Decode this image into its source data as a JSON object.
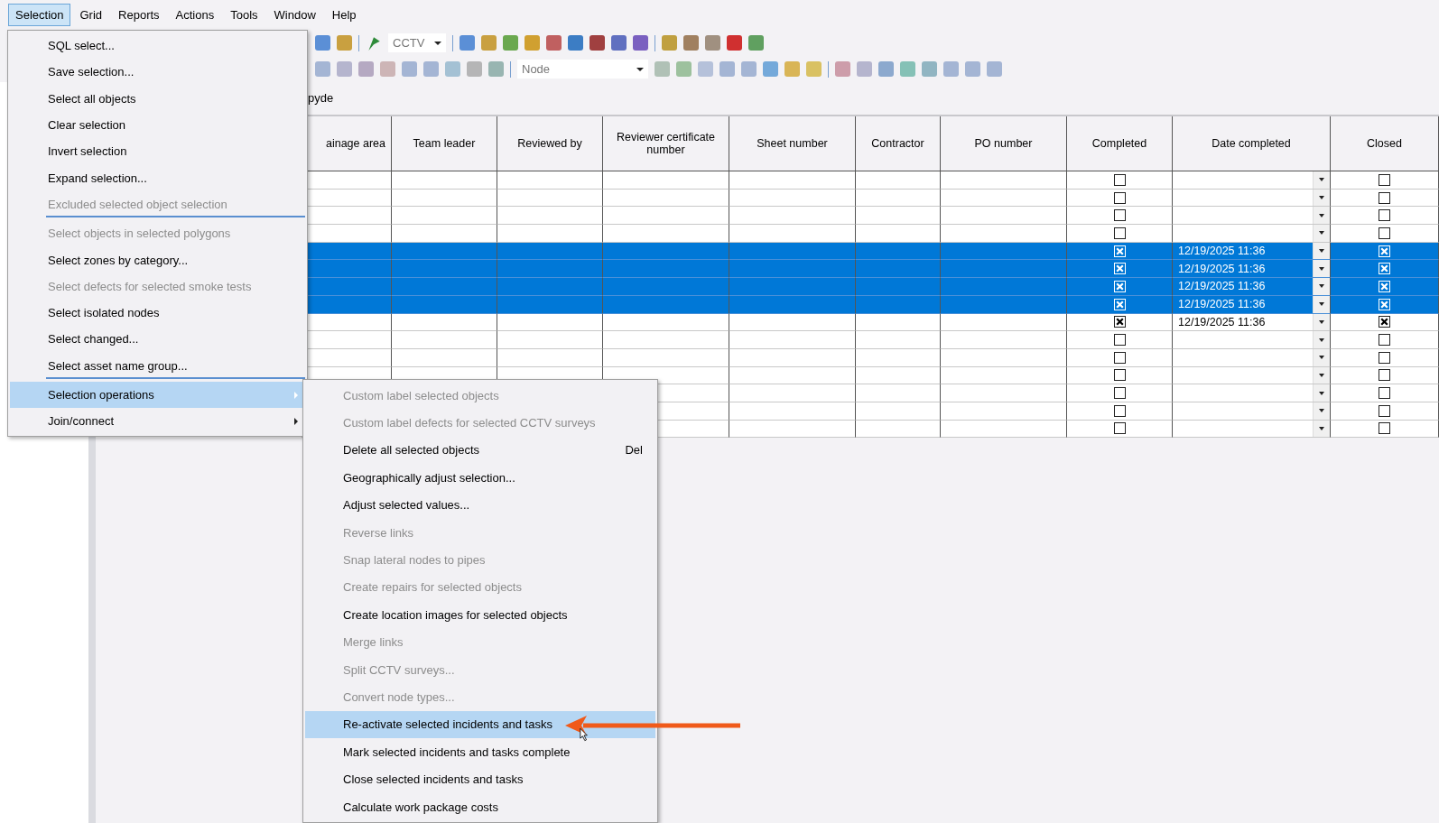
{
  "menubar": [
    {
      "label": "Selection",
      "selected": true
    },
    {
      "label": "Grid",
      "selected": false
    },
    {
      "label": "Reports",
      "selected": false
    },
    {
      "label": "Actions",
      "selected": false
    },
    {
      "label": "Tools",
      "selected": false
    },
    {
      "label": "Window",
      "selected": false
    },
    {
      "label": "Help",
      "selected": false
    }
  ],
  "toolbar": {
    "layer_combo": "CCTV",
    "object_combo": "Node"
  },
  "filter_field": {
    "value": "pyde"
  },
  "grid": {
    "columns": [
      "ainage area",
      "Team leader",
      "Reviewed by",
      "Reviewer certificate number",
      "Sheet number",
      "Contractor",
      "PO number",
      "Completed",
      "Date completed",
      "Closed"
    ],
    "rows": [
      {
        "selected": false,
        "completed": false,
        "date_completed": "",
        "closed": false
      },
      {
        "selected": false,
        "completed": false,
        "date_completed": "",
        "closed": false
      },
      {
        "selected": false,
        "completed": false,
        "date_completed": "",
        "closed": false
      },
      {
        "selected": false,
        "completed": false,
        "date_completed": "",
        "closed": false
      },
      {
        "selected": true,
        "completed": true,
        "date_completed": "12/19/2025 11:36",
        "closed": true
      },
      {
        "selected": true,
        "completed": true,
        "date_completed": "12/19/2025 11:36",
        "closed": true
      },
      {
        "selected": true,
        "completed": true,
        "date_completed": "12/19/2025 11:36",
        "closed": true
      },
      {
        "selected": true,
        "completed": true,
        "date_completed": "12/19/2025 11:36",
        "closed": true
      },
      {
        "selected": false,
        "completed": true,
        "date_completed": "12/19/2025 11:36",
        "closed": true
      },
      {
        "selected": false,
        "completed": false,
        "date_completed": "",
        "closed": false
      },
      {
        "selected": false,
        "completed": false,
        "date_completed": "",
        "closed": false
      },
      {
        "selected": false,
        "completed": false,
        "date_completed": "",
        "closed": false
      },
      {
        "selected": false,
        "completed": false,
        "date_completed": "",
        "closed": false
      },
      {
        "selected": false,
        "completed": false,
        "date_completed": "",
        "closed": false
      },
      {
        "selected": false,
        "completed": false,
        "date_completed": "",
        "closed": false
      }
    ]
  },
  "selection_menu": [
    {
      "label": "SQL select...",
      "disabled": false,
      "selected": false,
      "submenu": false,
      "separator_after": false
    },
    {
      "label": "Save selection...",
      "disabled": false,
      "selected": false,
      "submenu": false,
      "separator_after": false
    },
    {
      "label": "Select all objects",
      "disabled": false,
      "selected": false,
      "submenu": false,
      "separator_after": false
    },
    {
      "label": "Clear selection",
      "disabled": false,
      "selected": false,
      "submenu": false,
      "separator_after": false
    },
    {
      "label": "Invert selection",
      "disabled": false,
      "selected": false,
      "submenu": false,
      "separator_after": false
    },
    {
      "label": "Expand selection...",
      "disabled": false,
      "selected": false,
      "submenu": false,
      "separator_after": false
    },
    {
      "label": "Excluded selected object selection",
      "disabled": true,
      "selected": false,
      "submenu": false,
      "separator_after": true
    },
    {
      "label": "Select objects in selected polygons",
      "disabled": true,
      "selected": false,
      "submenu": false,
      "separator_after": false
    },
    {
      "label": "Select zones by category...",
      "disabled": false,
      "selected": false,
      "submenu": false,
      "separator_after": false
    },
    {
      "label": "Select defects for selected smoke tests",
      "disabled": true,
      "selected": false,
      "submenu": false,
      "separator_after": false
    },
    {
      "label": "Select isolated nodes",
      "disabled": false,
      "selected": false,
      "submenu": false,
      "separator_after": false
    },
    {
      "label": "Select changed...",
      "disabled": false,
      "selected": false,
      "submenu": false,
      "separator_after": false
    },
    {
      "label": "Select asset name group...",
      "disabled": false,
      "selected": false,
      "submenu": false,
      "separator_after": true
    },
    {
      "label": "Selection operations",
      "disabled": false,
      "selected": true,
      "submenu": true,
      "separator_after": false
    },
    {
      "label": "Join/connect",
      "disabled": false,
      "selected": false,
      "submenu": true,
      "separator_after": false
    }
  ],
  "selection_operations_submenu": [
    {
      "label": "Custom label selected objects",
      "disabled": true,
      "selected": false
    },
    {
      "label": "Custom label defects for selected CCTV surveys",
      "disabled": true,
      "selected": false
    },
    {
      "label": "Delete all selected objects",
      "disabled": false,
      "selected": false,
      "shortcut": "Del"
    },
    {
      "label": "Geographically adjust selection...",
      "disabled": false,
      "selected": false
    },
    {
      "label": "Adjust selected values...",
      "disabled": false,
      "selected": false
    },
    {
      "label": "Reverse links",
      "disabled": true,
      "selected": false
    },
    {
      "label": "Snap lateral nodes to pipes",
      "disabled": true,
      "selected": false
    },
    {
      "label": "Create repairs for selected objects",
      "disabled": true,
      "selected": false
    },
    {
      "label": "Create location images for selected objects",
      "disabled": false,
      "selected": false
    },
    {
      "label": "Merge links",
      "disabled": true,
      "selected": false
    },
    {
      "label": "Split CCTV surveys...",
      "disabled": true,
      "selected": false
    },
    {
      "label": "Convert node types...",
      "disabled": true,
      "selected": false
    },
    {
      "label": "Re-activate selected incidents and tasks",
      "disabled": false,
      "selected": true
    },
    {
      "label": "Mark selected incidents and tasks complete",
      "disabled": false,
      "selected": false
    },
    {
      "label": "Close selected incidents and tasks",
      "disabled": false,
      "selected": false
    },
    {
      "label": "Calculate work package costs",
      "disabled": false,
      "selected": false
    }
  ]
}
